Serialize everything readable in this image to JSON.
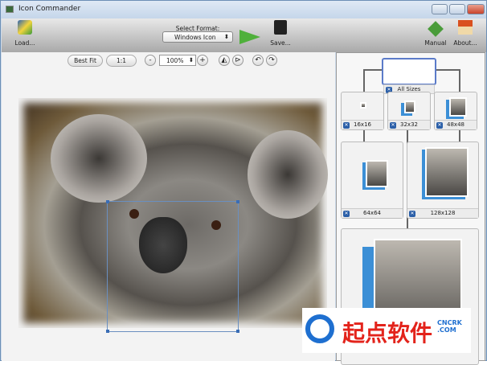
{
  "window": {
    "title": "Icon Commander"
  },
  "toolbar": {
    "load": "Load...",
    "select_format_label": "Select Format:",
    "format": "Windows Icon",
    "save": "Save...",
    "manual": "Manual",
    "about": "About..."
  },
  "view": {
    "best_fit": "Best Fit",
    "one_to_one": "1:1",
    "zoom_out": "-",
    "zoom": "100%",
    "zoom_in": "+"
  },
  "sizes": {
    "all": "All Sizes",
    "s16": "16x16",
    "s32": "32x32",
    "s48": "48x48",
    "s64": "64x64",
    "s128": "128x128"
  },
  "watermark": {
    "text": "起点软件",
    "sub": "CNCRK .COM"
  }
}
